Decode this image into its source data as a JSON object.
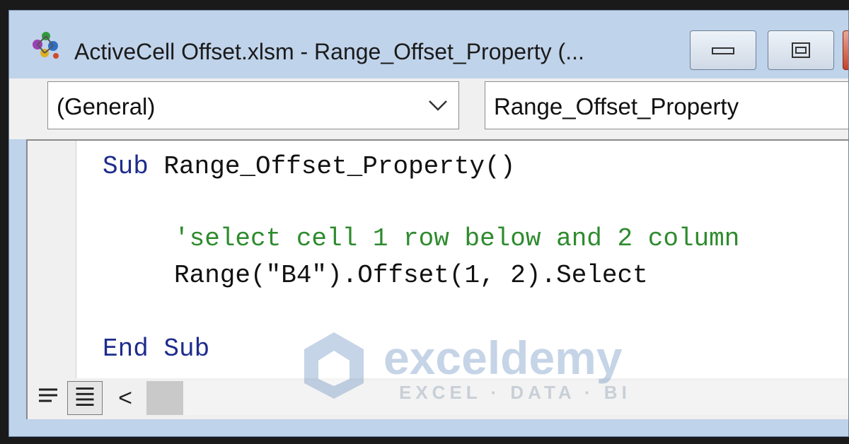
{
  "window": {
    "title": "ActiveCell Offset.xlsm - Range_Offset_Property (...",
    "icon": "vba-project-icon",
    "controls": [
      "minimize-icon",
      "maximize-icon",
      "close-icon"
    ]
  },
  "toolbar": {
    "object_dropdown": "(General)",
    "procedure_dropdown": "Range_Offset_Property"
  },
  "code": {
    "line1_kw": "Sub",
    "line1_rest": " Range_Offset_Property()",
    "comment": "'select cell 1 row below and 2 column",
    "statement": "Range(\"B4\").Offset(1, 2).Select",
    "end_kw1": "End",
    "end_kw2": "Sub"
  },
  "watermark": {
    "brand": "exceldemy",
    "tagline": "EXCEL · DATA · BI"
  },
  "bottom_bar": {
    "scroll_left": "<"
  },
  "colors": {
    "keyword": "#1e2c8c",
    "comment": "#2e8b2e",
    "window_frame": "#bfd3ea"
  }
}
